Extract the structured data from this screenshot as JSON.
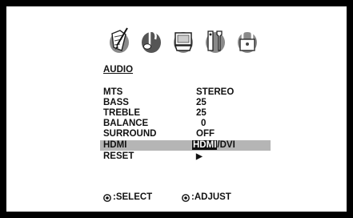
{
  "menu": {
    "tabs": [
      {
        "name": "picture",
        "icon": "paintbrush-icon"
      },
      {
        "name": "audio",
        "icon": "music-note-icon",
        "active": true
      },
      {
        "name": "channel",
        "icon": "tv-icon"
      },
      {
        "name": "setup",
        "icon": "tools-icon"
      },
      {
        "name": "lock",
        "icon": "padlock-icon"
      }
    ],
    "section_title": "AUDIO",
    "items": [
      {
        "label": "MTS",
        "value": "STEREO"
      },
      {
        "label": "BASS",
        "value": "25"
      },
      {
        "label": "TREBLE",
        "value": "25"
      },
      {
        "label": "BALANCE",
        "value": "0"
      },
      {
        "label": "SURROUND",
        "value": "OFF"
      },
      {
        "label": "HDMI",
        "value_selected": "HDMI",
        "value_separator": "/",
        "value_other": "DVI",
        "highlighted": true
      },
      {
        "label": "RESET",
        "value_icon": "play-arrow-icon",
        "value": "▶"
      }
    ]
  },
  "footer": {
    "select_hint": ":SELECT",
    "adjust_hint": ":ADJUST"
  },
  "colors": {
    "highlight_bar": "#b5b5b5",
    "text": "#111111",
    "background": "#ffffff",
    "frame": "#000000",
    "icon_inactive": "#888888",
    "icon_active": "#555555"
  }
}
